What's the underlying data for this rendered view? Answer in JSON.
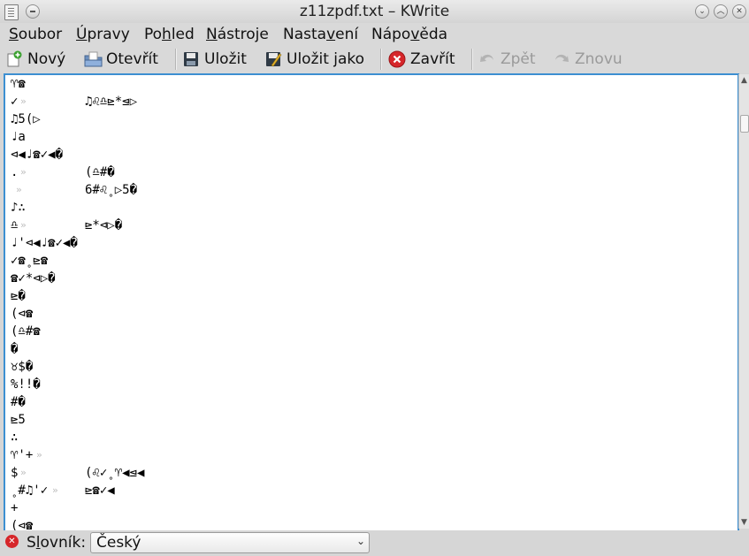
{
  "window": {
    "title": "z11zpdf.txt – KWrite",
    "buttons": {
      "menu_glyph": "⌄",
      "min_glyph": "︿",
      "close_glyph": "✕"
    }
  },
  "menubar": {
    "items": [
      {
        "pre": "",
        "u": "S",
        "post": "oubor"
      },
      {
        "pre": "",
        "u": "Ú",
        "post": "pravy"
      },
      {
        "pre": "Po",
        "u": "h",
        "post": "led"
      },
      {
        "pre": "",
        "u": "N",
        "post": "ástroje"
      },
      {
        "pre": "Nasta",
        "u": "v",
        "post": "ení"
      },
      {
        "pre": "Nápo",
        "u": "v",
        "post": "ěda"
      }
    ]
  },
  "toolbar": {
    "new_label": "Nový",
    "open_label": "Otevřít",
    "save_label": "Uložit",
    "saveas_label": "Uložit jako",
    "close_label": "Zavřít",
    "undo_label": "Zpět",
    "redo_label": "Znovu",
    "colors": {
      "close_icon": "#d6262a",
      "accent": "#3d8fd1"
    }
  },
  "editor": {
    "lines": [
      {
        "c1": "♈☎",
        "tab": "",
        "c2": ""
      },
      {
        "c1": "✓",
        "tab": "»",
        "c2": "♫♌♎⊵*⊴▷"
      },
      {
        "c1": "♫5(▷",
        "tab": "",
        "c2": ""
      },
      {
        "c1": "♩a",
        "tab": "",
        "c2": ""
      },
      {
        "c1": "⊲◀♩☎✓◀�",
        "tab": "",
        "c2": ""
      },
      {
        "c1": ".",
        "tab": "»",
        "c2": "(♎#�"
      },
      {
        "c1": "",
        "tab": "»",
        "c2": "6#♌˳▷5�"
      },
      {
        "c1": "♪∴",
        "tab": "",
        "c2": ""
      },
      {
        "c1": "♎",
        "tab": "»",
        "c2": "⊵*⊲▷�"
      },
      {
        "c1": "♩'⊲◀♩☎✓◀�",
        "tab": "",
        "c2": ""
      },
      {
        "c1": "✓☎˳⊵☎",
        "tab": "",
        "c2": ""
      },
      {
        "c1": "☎✓*⊲▷�",
        "tab": "",
        "c2": ""
      },
      {
        "c1": "⊵�",
        "tab": "",
        "c2": ""
      },
      {
        "c1": "(⊲☎",
        "tab": "",
        "c2": ""
      },
      {
        "c1": "(♎#☎",
        "tab": "",
        "c2": ""
      },
      {
        "c1": "�",
        "tab": "",
        "c2": ""
      },
      {
        "c1": "♉$�",
        "tab": "",
        "c2": ""
      },
      {
        "c1": "%!!�",
        "tab": "",
        "c2": ""
      },
      {
        "c1": "#�",
        "tab": "",
        "c2": ""
      },
      {
        "c1": "⊵5",
        "tab": "",
        "c2": ""
      },
      {
        "c1": "∴",
        "tab": "",
        "c2": ""
      },
      {
        "c1": "♈'+",
        "tab": "»",
        "c2": ""
      },
      {
        "c1": "$",
        "tab": "»",
        "c2": "(♌✓˳♈◀⊴◀"
      },
      {
        "c1": "˳#♫'✓",
        "tab": "»",
        "c2": "⊵☎✓◀"
      },
      {
        "c1": "+",
        "tab": "",
        "c2": ""
      },
      {
        "c1": "(⊲☎",
        "tab": "",
        "c2": ""
      }
    ]
  },
  "statusbar": {
    "dict_label_pre": "S",
    "dict_label_u": "l",
    "dict_label_post": "ovník:",
    "dict_value": "Český"
  }
}
